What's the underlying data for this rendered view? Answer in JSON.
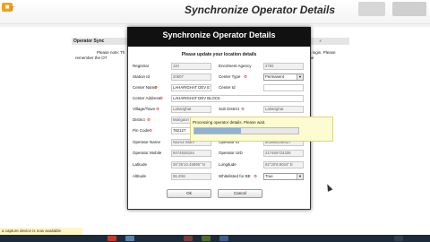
{
  "window": {
    "title": "Synchronize Operator Details",
    "logo_letter": "r"
  },
  "background": {
    "section_title": "Operator Sync",
    "note_line1": "Please note: Th",
    "note_line2": "remember the OT",
    "note_right1": "in login. Please",
    "note_right2": "the",
    "status_text": "a capture device is now available"
  },
  "dialog": {
    "title": "Synchronize Operator Details",
    "subtitle": "Please update your location details",
    "fields": {
      "registrar": {
        "label": "Registrar",
        "value": "110"
      },
      "enrolment_agency": {
        "label": "Enrolment Agency",
        "value": "2782"
      },
      "station_id": {
        "label": "Station Id",
        "value": "20507"
      },
      "center_type": {
        "label": "Center Type",
        "value": "Permanent"
      },
      "center_name": {
        "label": "Center Name",
        "value": "LAHARIGHAT DEV E"
      },
      "center_id": {
        "label": "Center Id",
        "value": ""
      },
      "center_address": {
        "label": "Center Address",
        "value": "LAHARIGHAT DEV BLOCK"
      },
      "village_town": {
        "label": "Village/Town",
        "value": "Laharighat"
      },
      "sub_district": {
        "label": "Sub District",
        "value": "Laharighat"
      },
      "district": {
        "label": "District",
        "value": "Marigaon"
      },
      "pin_code": {
        "label": "Pin Code",
        "value": "782127"
      },
      "operator_name": {
        "label": "Operator Name",
        "value": "Nazrul Islam"
      },
      "operator_id": {
        "label": "Operator Id",
        "value": "903985156427"
      },
      "operator_mobile": {
        "label": "Operator Mobile",
        "value": "9474826164"
      },
      "operator_uid": {
        "label": "Operator UID",
        "value": "217465724335"
      },
      "latitude": {
        "label": "Latitude",
        "value": "26°25'10.45896\" N"
      },
      "longitude": {
        "label": "Longitude",
        "value": "92°20'8.9024\" E"
      },
      "altitude": {
        "label": "Altitude",
        "value": "55.29m"
      },
      "whitelisted": {
        "label": "Whitelisted for BE",
        "value": "True"
      }
    },
    "buttons": {
      "ok": "Ok",
      "cancel": "Cancel"
    }
  },
  "processing": {
    "message": "Processing operator details. Please wait.",
    "progress": 0.45
  },
  "colors": {
    "dialog_header": "#111111",
    "required": "#cc2b2b",
    "processing_bg": "#fdfbd0",
    "progress_fill": "#8fb1d6"
  }
}
